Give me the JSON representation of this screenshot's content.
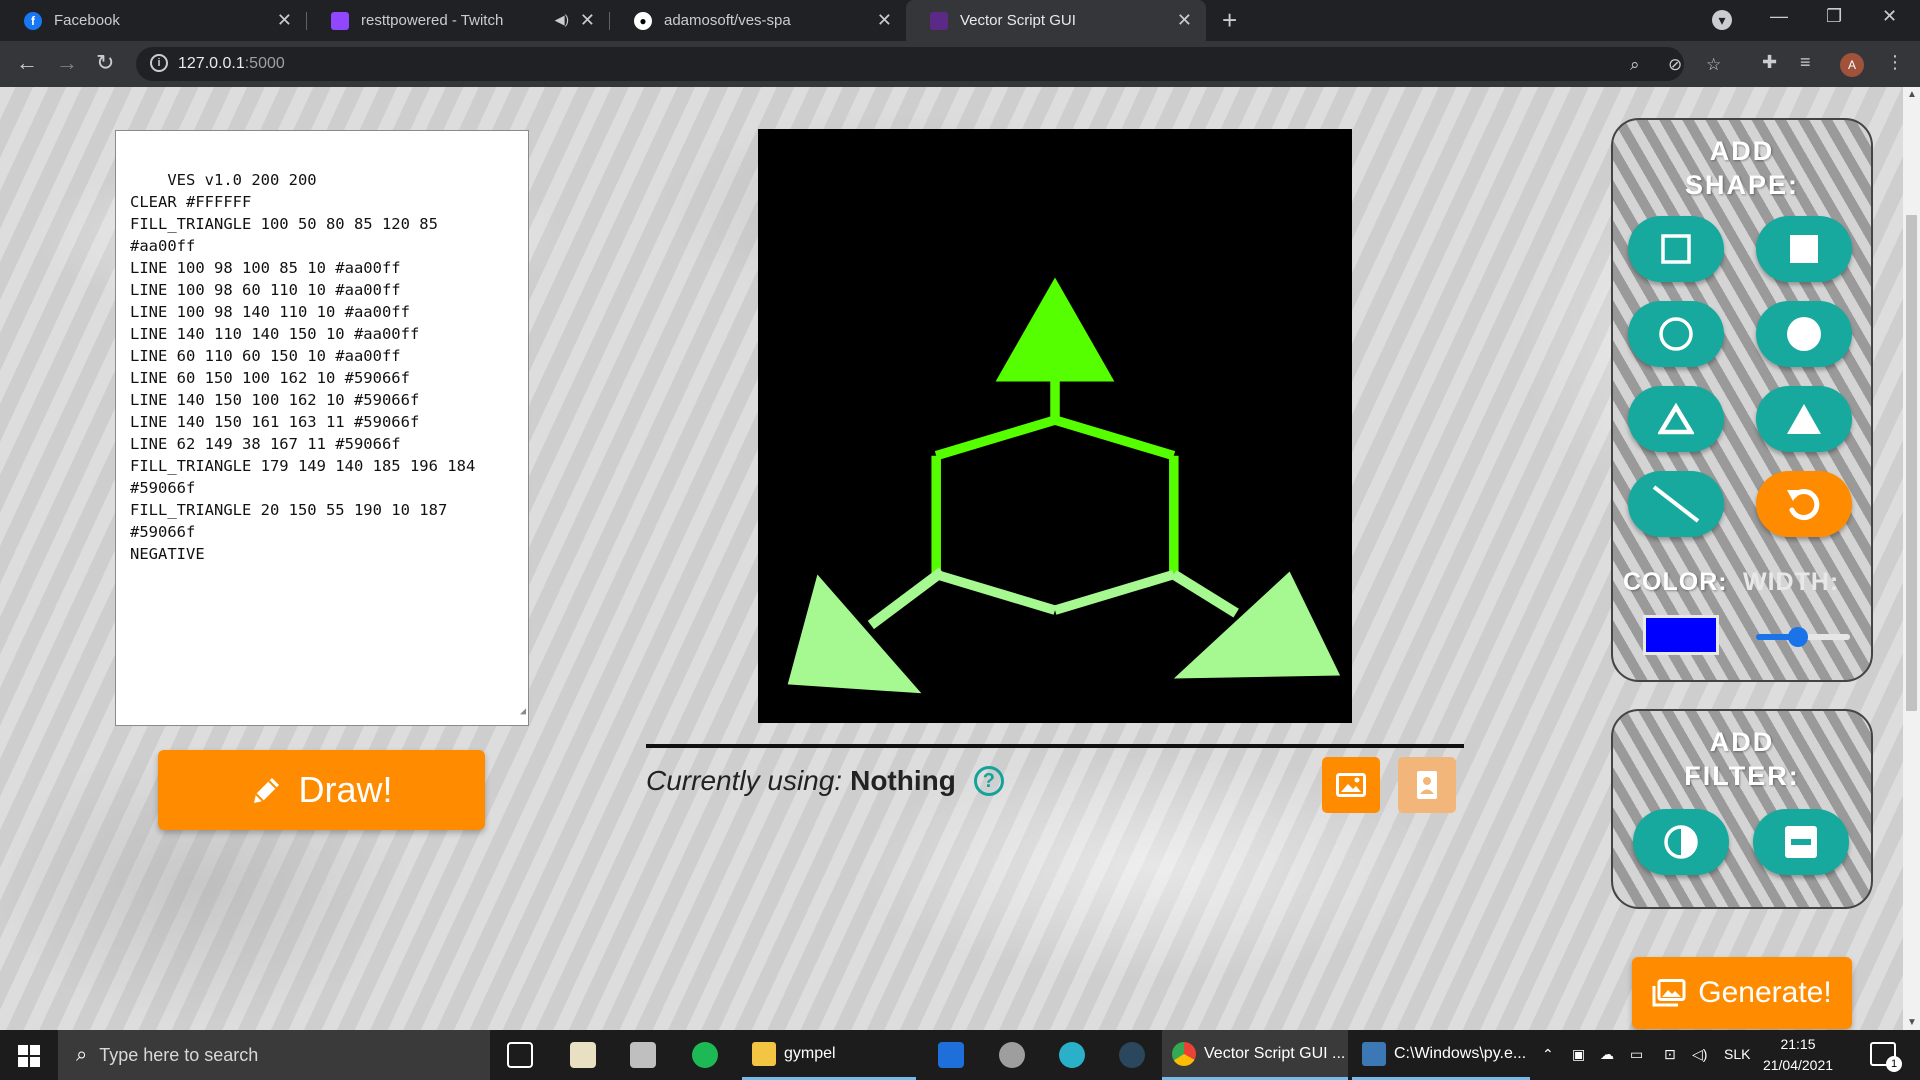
{
  "browser": {
    "tabs": [
      {
        "title": "Facebook",
        "favicon": "facebook-icon"
      },
      {
        "title": "resttpowered - Twitch",
        "favicon": "twitch-icon",
        "muted": true
      },
      {
        "title": "adamosoft/ves-spa",
        "favicon": "github-icon"
      },
      {
        "title": "Vector Script GUI",
        "favicon": "vsg-icon",
        "active": true
      }
    ],
    "url_host": "127.0.0.1",
    "url_port": ":5000",
    "profile_initial": "A"
  },
  "editor": {
    "code": "VES v1.0 200 200\nCLEAR #FFFFFF\nFILL_TRIANGLE 100 50 80 85 120 85\n#aa00ff\nLINE 100 98 100 85 10 #aa00ff\nLINE 100 98 60 110 10 #aa00ff\nLINE 100 98 140 110 10 #aa00ff\nLINE 140 110 140 150 10 #aa00ff\nLINE 60 110 60 150 10 #aa00ff\nLINE 60 150 100 162 10 #59066f\nLINE 140 150 100 162 10 #59066f\nLINE 140 150 161 163 11 #59066f\nLINE 62 149 38 167 11 #59066f\nFILL_TRIANGLE 179 149 140 185 196 184\n#59066f\nFILL_TRIANGLE 20 150 55 190 10 187\n#59066f\nNEGATIVE"
  },
  "draw_button": {
    "label": "Draw!"
  },
  "status": {
    "prefix": "Currently using:",
    "value": "Nothing",
    "help": "?"
  },
  "shape_panel": {
    "title": "ADD SHAPE:",
    "color_label": "COLOR:",
    "width_label": "WIDTH:",
    "current_color": "#0000ff",
    "width_value_fraction": 0.45
  },
  "filter_panel": {
    "title": "ADD FILTER:"
  },
  "generate_button": {
    "label": "Generate!"
  },
  "colors": {
    "accent_orange": "#ff8c00",
    "teal": "#17a89e",
    "bright_green": "#55ff00",
    "light_green": "#a6f990"
  },
  "taskbar": {
    "search_placeholder": "Type here to search",
    "apps": [
      {
        "label": "gympel"
      },
      {
        "label": "Vector Script GUI ..."
      },
      {
        "label": "C:\\Windows\\py.e..."
      }
    ],
    "tray_lang": "SLK",
    "time": "21:15",
    "date": "21/04/2021",
    "notifications": "1"
  }
}
